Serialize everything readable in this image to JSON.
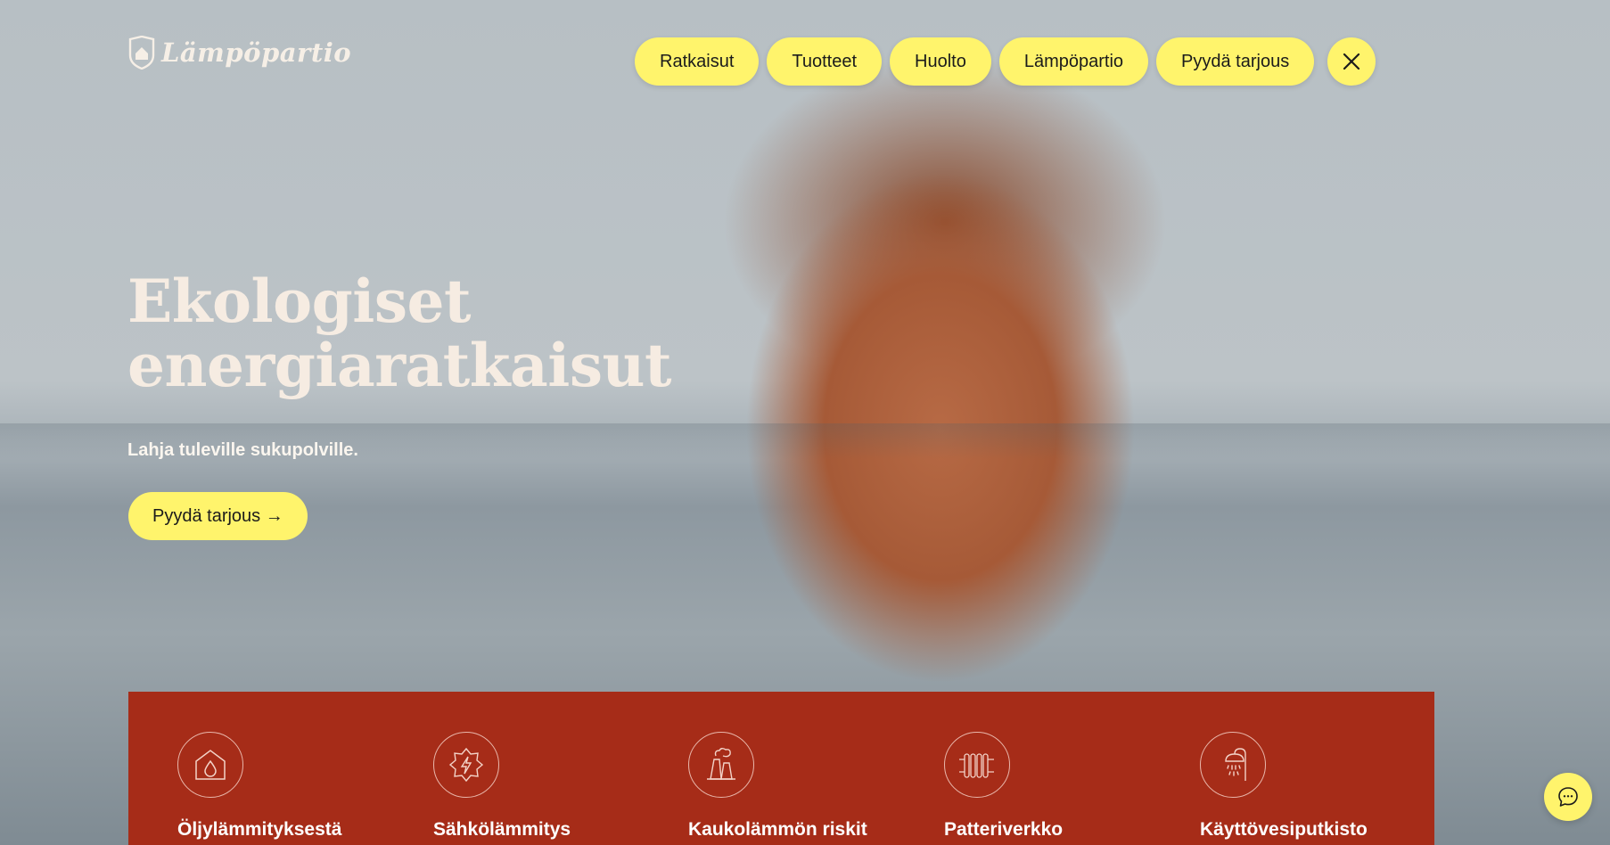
{
  "brand": {
    "name": "Lämpöpartio",
    "logo_icon": "house-shield-icon"
  },
  "nav": {
    "items": [
      {
        "label": "Ratkaisut"
      },
      {
        "label": "Tuotteet"
      },
      {
        "label": "Huolto"
      },
      {
        "label": "Lämpöpartio"
      },
      {
        "label": "Pyydä tarjous"
      }
    ],
    "close_icon": "close-icon"
  },
  "hero": {
    "headline_line1": "Ekologiset",
    "headline_line2": "energiaratkaisut",
    "subtitle": "Lahja tuleville sukupolville.",
    "cta_label": "Pyydä tarjous →"
  },
  "services": [
    {
      "label": "Öljylämmityksestä",
      "icon": "oil-drop-house-icon"
    },
    {
      "label": "Sähkölämmitys",
      "icon": "lightning-icon"
    },
    {
      "label": "Kaukolämmön riskit",
      "icon": "district-heating-plant-icon"
    },
    {
      "label": "Patteriverkko",
      "icon": "radiator-icon"
    },
    {
      "label": "Käyttövesiputkisto",
      "icon": "shower-icon"
    }
  ],
  "chat": {
    "icon": "chat-bubble-icon"
  },
  "colors": {
    "accent": "#fff46c",
    "panel": "#a62c18",
    "headline": "#f6ece2"
  }
}
